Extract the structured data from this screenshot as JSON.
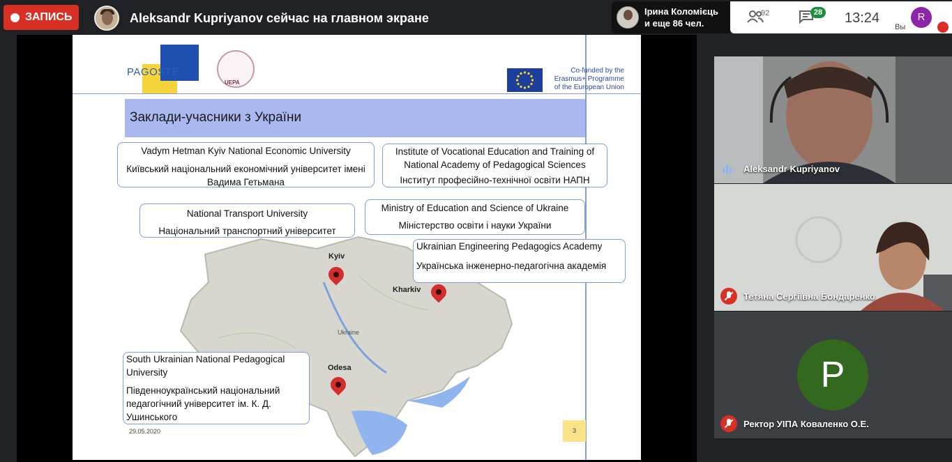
{
  "topbar": {
    "record_label": "ЗАПИСЬ",
    "presenting_text": "Aleksandr Kupriyanov сейчас на главном экране",
    "viewers_line1": "Ірина Коломієць",
    "viewers_line2": "и еще 86 чел.",
    "people_count": "92",
    "chat_badge": "28",
    "clock": "13:24",
    "self_initial": "R",
    "self_label": "Вы"
  },
  "slide": {
    "logo_text": "PAGOSTE",
    "uepa_text": "UEPA",
    "eu_text_1": "Co-funded by the",
    "eu_text_2": "Erasmus+ Programme",
    "eu_text_3": "of the European Union",
    "title": "Заклади-учасники з України",
    "boxes": [
      {
        "en": "Vadym Hetman Kyiv National Economic University",
        "uk": "Київський національний економічний університет імені Вадима Гетьмана"
      },
      {
        "en": "Institute of Vocational Education and Training of National Academy of Pedagogical Sciences",
        "uk": "Інститут професійно-технічної освіти НАПН"
      },
      {
        "en": "National Transport University",
        "uk": "Національний транспортний університет"
      },
      {
        "en": "Ministry of Education and Science of Ukraine",
        "uk": "Міністерство освіти і науки України"
      },
      {
        "en": "Ukrainian Engineering Pedagogics Academy",
        "uk": "Українська інженерно-педагогічна академія"
      },
      {
        "en": "South Ukrainian National Pedagogical University",
        "uk": "Південноукраїнський національний педагогічний університет ім. К. Д. Ушинського"
      }
    ],
    "cities": {
      "kyiv": "Kyiv",
      "kharkiv": "Kharkiv",
      "odesa": "Odesa",
      "country": "Ukraine"
    },
    "date": "29.05.2020",
    "page": "3"
  },
  "participants": [
    {
      "name": "Aleksandr Kupriyanov"
    },
    {
      "name": "Тетяна Сергіївна Бондаренко"
    },
    {
      "name": "Ректор УІПА Коваленко О.Е.",
      "initial": "P"
    }
  ],
  "colors": {
    "record": "#d93025",
    "accent_green": "#1e8e3e",
    "avatar_green": "#33691e",
    "self_avatar": "#8e24aa"
  }
}
